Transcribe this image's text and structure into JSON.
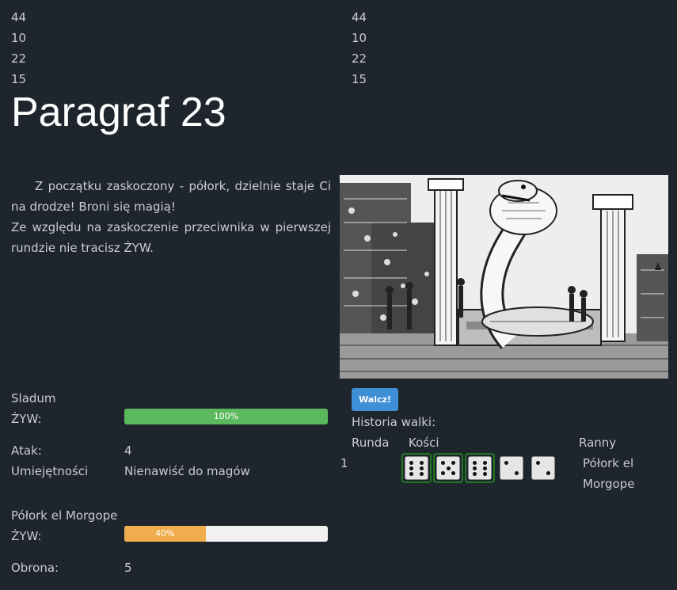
{
  "stats_left": [
    "44",
    "10",
    "22",
    "15"
  ],
  "stats_right": [
    "44",
    "10",
    "22",
    "15"
  ],
  "title": "Paragraf 23",
  "paragraph": {
    "line1": "Z początku zaskoczony - półork, dzielnie staje Ci na drodze! Broni się magią!",
    "line2": "Ze względu na zaskoczenie przeciwnika w pierwszej rundzie nie tracisz ŻYW."
  },
  "player": {
    "name": "Sladum",
    "hp_label": "ŻYW:",
    "hp_percent": 100,
    "hp_text": "100%",
    "attack_label": "Atak:",
    "attack_value": "4",
    "skills_label": "Umiejętności",
    "skills_value": "Nienawiść do magów"
  },
  "enemy": {
    "name": "Półork el Morgope",
    "hp_label": "ŻYW:",
    "hp_percent": 40,
    "hp_text": "40%",
    "defense_label": "Obrona:",
    "defense_value": "5"
  },
  "colors": {
    "player_bar": "#5cb85c",
    "enemy_bar": "#f0ad4e",
    "die_highlight": "#1f7a1f",
    "button": "#3e8fd6"
  },
  "fight": {
    "button_label": "Walcz!",
    "history_title": "Historia walki:",
    "col_round": "Runda",
    "col_dice": "Kości",
    "col_wounded": "Ranny",
    "round_number": "1",
    "dice": [
      {
        "value": 6,
        "highlighted": true
      },
      {
        "value": 5,
        "highlighted": true
      },
      {
        "value": 6,
        "highlighted": true
      },
      {
        "value": 2,
        "highlighted": false
      },
      {
        "value": 2,
        "highlighted": false
      }
    ],
    "wounded_line1": "Półork el",
    "wounded_line2": "Morgope"
  },
  "illustration": {
    "icon": "cobra-temple-illustration"
  }
}
